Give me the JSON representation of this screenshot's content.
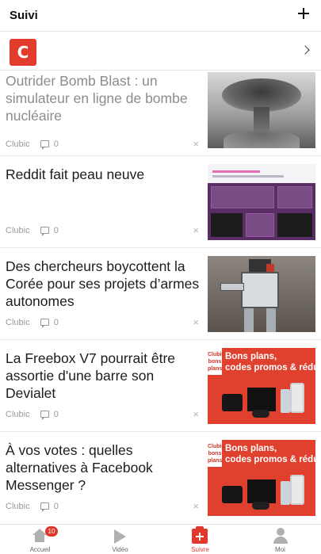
{
  "header": {
    "title": "Suivi"
  },
  "source": {
    "logo_letter": "C"
  },
  "articles": [
    {
      "headline": "Outrider Bomb Blast : un simulateur en ligne de bombe nucléaire",
      "source": "Clubic",
      "comments": "0",
      "dismiss": "×",
      "thumb_icon": "nuclear-explosion-image"
    },
    {
      "headline": "Reddit fait peau neuve",
      "source": "Clubic",
      "comments": "0",
      "dismiss": "×",
      "thumb_icon": "reddit-redesign-screenshot"
    },
    {
      "headline": "Des chercheurs boycottent la Corée pour ses projets d’armes autonomes",
      "source": "Clubic",
      "comments": "0",
      "dismiss": "×",
      "thumb_icon": "robot-image"
    },
    {
      "headline": "La Freebox V7 pourrait être assortie d'une barre son Devialet",
      "source": "Clubic",
      "comments": "0",
      "dismiss": "×",
      "thumb_icon": "bons-plans-banner",
      "thumb_tag": "Clubic bons plans",
      "thumb_line1": "Bons plans,",
      "thumb_line2": "codes promos & réductions"
    },
    {
      "headline": "À vos votes : quelles alternatives à Facebook Messenger ?",
      "source": "Clubic",
      "comments": "0",
      "dismiss": "×",
      "thumb_icon": "bons-plans-banner",
      "thumb_tag": "Clubic bons plans",
      "thumb_line1": "Bons plans,",
      "thumb_line2": "codes promos & réductions"
    }
  ],
  "tabs": [
    {
      "label": "Accueil",
      "badge": "10"
    },
    {
      "label": "Vidéo"
    },
    {
      "label": "Suivre",
      "active": true
    },
    {
      "label": "Moi"
    }
  ],
  "colors": {
    "accent": "#e0362b",
    "logo": "#e33b2e"
  }
}
